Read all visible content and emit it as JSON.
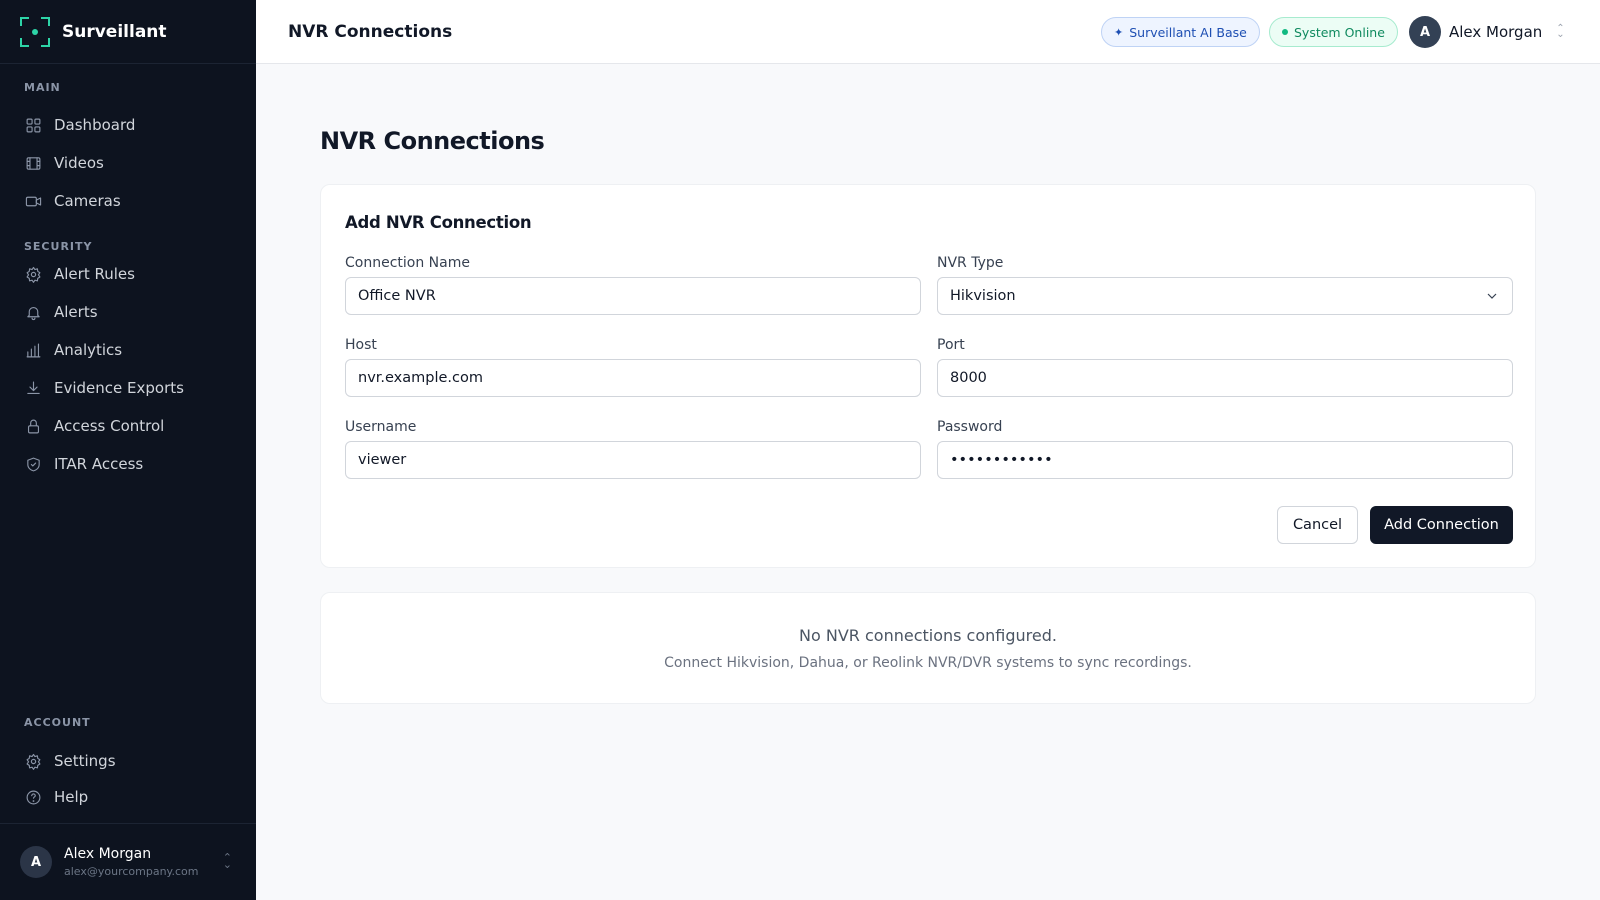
{
  "app": {
    "name": "Surveillant"
  },
  "sidebar": {
    "sections": {
      "main": "MAIN",
      "security": "SECURITY",
      "account": "ACCOUNT"
    },
    "items": [
      {
        "label": "Dashboard",
        "icon": "grid-icon"
      },
      {
        "label": "Videos",
        "icon": "film-icon"
      },
      {
        "label": "Cameras",
        "icon": "video-camera-icon"
      },
      {
        "label": "Alert Rules",
        "icon": "gear-icon"
      },
      {
        "label": "Alerts",
        "icon": "bell-icon"
      },
      {
        "label": "Analytics",
        "icon": "bar-chart-icon"
      },
      {
        "label": "Evidence Exports",
        "icon": "download-icon"
      },
      {
        "label": "Access Control",
        "icon": "lock-icon"
      },
      {
        "label": "ITAR Access",
        "icon": "shield-check-icon"
      },
      {
        "label": "Settings",
        "icon": "gear-icon"
      },
      {
        "label": "Help",
        "icon": "help-circle-icon"
      }
    ],
    "user": {
      "initial": "A",
      "name": "Alex Morgan",
      "email": "alex@yourcompany.com"
    }
  },
  "header": {
    "title": "NVR Connections",
    "ai_badge": "Surveillant AI Base",
    "status_badge": "System Online",
    "user": {
      "initial": "A",
      "name": "Alex Morgan"
    }
  },
  "main": {
    "title": "NVR Connections",
    "form": {
      "title": "Add NVR Connection",
      "fields": {
        "connection_name": {
          "label": "Connection Name",
          "value": "Office NVR"
        },
        "nvr_type": {
          "label": "NVR Type",
          "value": "Hikvision"
        },
        "host": {
          "label": "Host",
          "value": "nvr.example.com"
        },
        "port": {
          "label": "Port",
          "value": "8000"
        },
        "username": {
          "label": "Username",
          "value": "viewer"
        },
        "password": {
          "label": "Password",
          "value": "••••••••••••"
        }
      },
      "cancel_label": "Cancel",
      "submit_label": "Add Connection"
    },
    "empty_state": {
      "title": "No NVR connections configured.",
      "subtitle": "Connect Hikvision, Dahua, or Reolink NVR/DVR systems to sync recordings."
    }
  },
  "colors": {
    "sidebar_bg": "#0d131f",
    "accent": "#2dd4a7",
    "primary_button": "#111827",
    "online_green": "#10b981"
  }
}
